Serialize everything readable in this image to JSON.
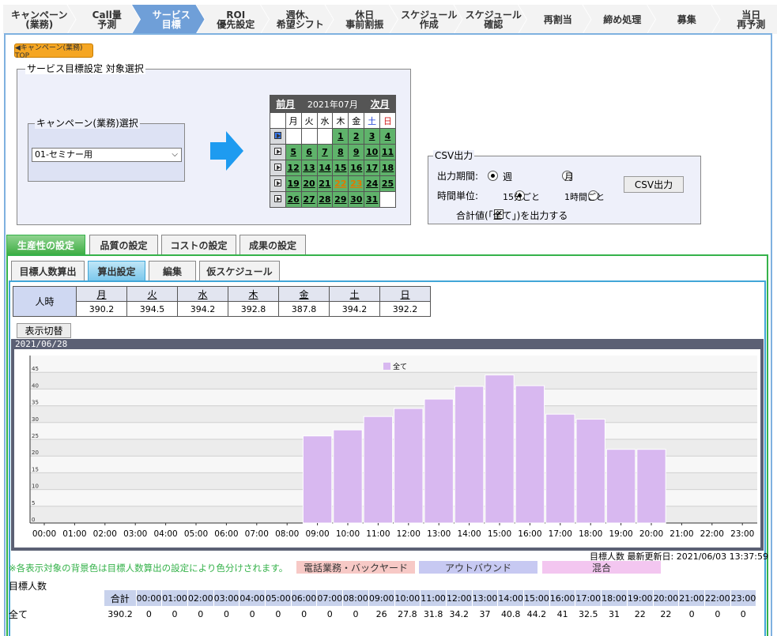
{
  "nav_tabs": [
    {
      "label": "キャンペーン\n(業務)",
      "active": false
    },
    {
      "label": "Call量\n予測",
      "active": false
    },
    {
      "label": "サービス\n目標",
      "active": true
    },
    {
      "label": "ROI\n優先設定",
      "active": false
    },
    {
      "label": "週休、\n希望シフト",
      "active": false
    },
    {
      "label": "休日\n事前割振",
      "active": false
    },
    {
      "label": "スケジュール\n作成",
      "active": false
    },
    {
      "label": "スケジュール\n確認",
      "active": false
    },
    {
      "label": "再割当",
      "active": false
    },
    {
      "label": "締め処理",
      "active": false
    },
    {
      "label": "募集",
      "active": false
    },
    {
      "label": "当日\n再予測",
      "active": false
    }
  ],
  "top_button": "◀キャンペーン(業務) TOP",
  "target": {
    "legend": "サービス目標設定 対象選択",
    "campaign_legend": "キャンペーン(業務)選択",
    "campaign_value": "01-セミナー用"
  },
  "calendar": {
    "prev": "前月",
    "month": "2021年07月",
    "next": "次月",
    "weekdays": [
      "月",
      "火",
      "水",
      "木",
      "金",
      "土",
      "日"
    ],
    "weeks": [
      [
        "",
        "",
        "",
        "1",
        "2",
        "3",
        "4"
      ],
      [
        "5",
        "6",
        "7",
        "8",
        "9",
        "10",
        "11"
      ],
      [
        "12",
        "13",
        "14",
        "15",
        "16",
        "17",
        "18"
      ],
      [
        "19",
        "20",
        "21",
        "22",
        "23",
        "24",
        "25"
      ],
      [
        "26",
        "27",
        "28",
        "29",
        "30",
        "31",
        ""
      ]
    ],
    "holidays": [
      "22",
      "23"
    ]
  },
  "csv": {
    "legend": "CSV出力",
    "period_label": "出力期間:",
    "period_options": [
      "週",
      "月"
    ],
    "period_selected": "週",
    "unit_label": "時間単位:",
    "unit_options": [
      "15分ごと",
      "1時間ごと"
    ],
    "unit_selected": "15分ごと",
    "total_checkbox": "合計値(「全て」)を出力する",
    "total_checked": true,
    "button": "CSV出力"
  },
  "settings_tabs": [
    "生産性の設定",
    "品質の設定",
    "コストの設定",
    "成果の設定"
  ],
  "sub_tabs": [
    "目標人数算出",
    "算出設定",
    "編集",
    "仮スケジュール"
  ],
  "weekly": {
    "row_label": "人時",
    "days": [
      "月",
      "火",
      "水",
      "木",
      "金",
      "土",
      "日"
    ],
    "values": [
      "390.2",
      "394.5",
      "394.2",
      "392.8",
      "387.8",
      "394.2",
      "392.2"
    ]
  },
  "toggle_button": "表示切替",
  "chart_header_date": "2021/06/28",
  "chart_data": {
    "type": "bar",
    "categories": [
      "00:00",
      "01:00",
      "02:00",
      "03:00",
      "04:00",
      "05:00",
      "06:00",
      "07:00",
      "08:00",
      "09:00",
      "10:00",
      "11:00",
      "12:00",
      "13:00",
      "14:00",
      "15:00",
      "16:00",
      "17:00",
      "18:00",
      "19:00",
      "20:00",
      "21:00",
      "22:00",
      "23:00"
    ],
    "series": [
      {
        "name": "全て",
        "color": "#d8b8f0",
        "values": [
          0,
          0,
          0,
          0,
          0,
          0,
          0,
          0,
          0,
          26,
          27.8,
          31.8,
          34.2,
          37,
          40.8,
          44.2,
          41,
          32.5,
          31,
          22,
          22,
          0,
          0,
          0
        ]
      }
    ],
    "y_ticks": [
      "0",
      "5",
      "10",
      "15",
      "20",
      "25",
      "30",
      "35",
      "40",
      "45"
    ],
    "ylim": [
      0,
      50
    ],
    "legend_position": "top-center",
    "grid": true
  },
  "updated": "目標人数 最新更新日: 2021/06/03 13:37:59",
  "note": "※各表示対象の背景色は目標人数算出の設定により色分けされます。",
  "legend_items": [
    {
      "label": "電話業務・バックヤード",
      "color": "#f7c9c6"
    },
    {
      "label": "アウトバウンド",
      "color": "#c7c9f2"
    },
    {
      "label": "混合",
      "color": "#f3c6f0"
    }
  ],
  "bottom": {
    "title": "目標人数",
    "total_header": "合計",
    "row_label": "全て",
    "total": "390.2",
    "hours": [
      "00:00",
      "01:00",
      "02:00",
      "03:00",
      "04:00",
      "05:00",
      "06:00",
      "07:00",
      "08:00",
      "09:00",
      "10:00",
      "11:00",
      "12:00",
      "13:00",
      "14:00",
      "15:00",
      "16:00",
      "17:00",
      "18:00",
      "19:00",
      "20:00",
      "21:00",
      "22:00",
      "23:00"
    ],
    "values": [
      "0",
      "0",
      "0",
      "0",
      "0",
      "0",
      "0",
      "0",
      "0",
      "26",
      "27.8",
      "31.8",
      "34.2",
      "37",
      "40.8",
      "44.2",
      "41",
      "32.5",
      "31",
      "22",
      "22",
      "0",
      "0",
      "0"
    ]
  }
}
